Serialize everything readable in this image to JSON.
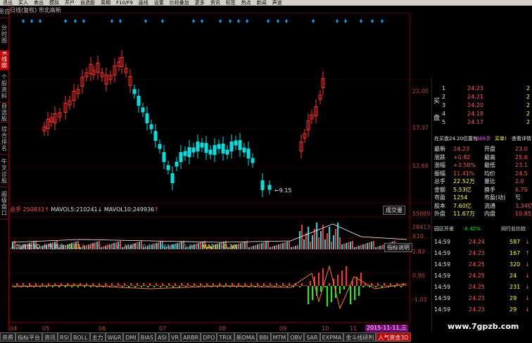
{
  "menu": [
    "退出",
    "买入",
    "卖出",
    "模拟",
    "开户",
    "自选股",
    "周期",
    "F10/F9",
    "画线",
    "设置",
    "比较叠加",
    "更多",
    "资讯",
    "标签",
    "热点",
    "新闻",
    "声道"
  ],
  "left_tabs": [
    "应用",
    "分时图",
    "K线图",
    "个股资料",
    "自选股",
    "综合排名",
    "牛叉诊股",
    "超级盘口"
  ],
  "chart_title": "日线(复权) 市北高新",
  "price_axis": [
    "22.00",
    "17.37",
    "12.68"
  ],
  "price_low_label": "←9.15",
  "volume": {
    "label": "总手",
    "value": "250833",
    "mavol5_label": "MAVOL5:",
    "mavol5": "210241",
    "mavol10_label": "MAVOL10:",
    "mavol10": "249936",
    "button": "成交量",
    "axis": [
      "55689",
      "28413",
      "X10"
    ]
  },
  "indicator": {
    "name": "人气资金3D",
    "ind_label": "人气资金:",
    "ind_val": "0.01",
    "ma3": "MA3: -0.03",
    "ma5": "MA5: -0.19",
    "ma10": "MA10: -0.36",
    "ma20": "MA20: -0.30",
    "button": "指标说明",
    "axis": [
      "2.82",
      "0.90",
      "-1.01"
    ]
  },
  "x_axis": [
    "04",
    "05",
    "06",
    "07",
    "08",
    "09",
    "10",
    "11"
  ],
  "date_badge": "2015-11-11,三",
  "orderbook": {
    "buy_label": "买",
    "sell_label": "盘",
    "rows": [
      {
        "n": "1",
        "price": "24.23",
        "vol": "2"
      },
      {
        "n": "2",
        "price": "24.21",
        "vol": "2"
      },
      {
        "n": "3",
        "price": "24.20",
        "vol": "2"
      },
      {
        "n": "4",
        "price": "24.18",
        "vol": "2"
      },
      {
        "n": "5",
        "price": "24.17",
        "vol": "2"
      }
    ]
  },
  "notice": {
    "text": "在买盘24.20位置有",
    "vol": "306手",
    "link": "买单!",
    "link2": "查看详情"
  },
  "quote": [
    {
      "k1": "最新",
      "v1": "24.23",
      "k2": "开盘",
      "v2": "23.0"
    },
    {
      "k1": "涨跌",
      "v1": "+0.82",
      "k2": "最高",
      "v2": "25.6"
    },
    {
      "k1": "涨幅",
      "v1": "+3.50%",
      "k2": "最低",
      "v2": "23.1"
    },
    {
      "k1": "振幅",
      "v1": "11.41%",
      "k2": "均价",
      "v2": "24.5"
    },
    {
      "k1": "总手",
      "v1": "22.52万",
      "k2": "量比",
      "v2": "2.0"
    },
    {
      "k1": "金额",
      "v1": "5.53亿",
      "k2": "换手",
      "v2": "6.75"
    },
    {
      "k1": "市盈",
      "v1": "1254",
      "k2": "市盈(动)",
      "v2": "亏"
    },
    {
      "k1": "股本",
      "v1": "7.60亿",
      "k2": "流通",
      "v2": "3.34亿"
    },
    {
      "k1": "外盘",
      "v1": "11.67万",
      "k2": "内盘",
      "v2": "10.85万"
    }
  ],
  "sector": {
    "name": "园区开发",
    "change": "-6.42%",
    "link": "同行业比较"
  },
  "ticks": [
    {
      "t": "14:59",
      "p": "24.24",
      "v": "587"
    },
    {
      "t": "14:59",
      "p": "24.23",
      "v": "167"
    },
    {
      "t": "14:59",
      "p": "24.25",
      "v": "320"
    },
    {
      "t": "14:59",
      "p": "24.25",
      "v": "24"
    },
    {
      "t": "14:59",
      "p": "24.25",
      "v": "231"
    },
    {
      "t": "14:59",
      "p": "24.23",
      "v": "29"
    },
    {
      "t": "14:59",
      "p": "24.23",
      "v": "29"
    }
  ],
  "bottom_tabs": [
    "资费",
    "指标平台",
    "资讯",
    "RSI",
    "BOLL",
    "主力",
    "W&R",
    "DMI",
    "BIAS",
    "ASI",
    "VR",
    "ARBR",
    "DPO",
    "TRIX",
    "新DMA",
    "BBI",
    "MTM",
    "OBV",
    "SAR",
    "EXPMA",
    "金斗线研判",
    "人气资金3D"
  ],
  "watermark": "www.7gpzb.com",
  "colors": {
    "up": "#ff3030",
    "down": "#00e0e0",
    "grid": "#800000",
    "bg": "#000000"
  }
}
